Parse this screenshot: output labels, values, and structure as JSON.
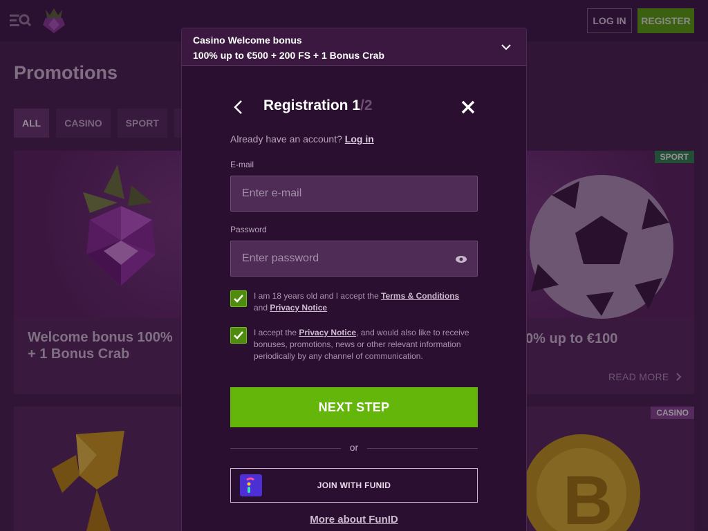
{
  "header": {
    "login_label": "LOG IN",
    "register_label": "REGISTER"
  },
  "page": {
    "title": "Promotions",
    "tabs": [
      "ALL",
      "CASINO",
      "SPORT",
      "S"
    ]
  },
  "cards": {
    "left_title_line1": "Welcome bonus 100%",
    "left_title_line2": "+ 1 Bonus Crab",
    "right_title": "0% up to €100",
    "right_badge": "SPORT",
    "bottom_right_badge": "CASINO",
    "read_more": "READ MORE"
  },
  "modal": {
    "bonus_title": "Casino Welcome bonus",
    "bonus_offer": "100% up to €500 + 200 FS + 1 Bonus Crab",
    "title": "Registration",
    "step": "1",
    "total": "/2",
    "account_prompt": "Already have an account?",
    "login_link": "Log in",
    "email_label": "E-mail",
    "email_placeholder": "Enter e-mail",
    "password_label": "Password",
    "password_placeholder": "Enter password",
    "terms_text_a": "I am 18 years old and I accept the ",
    "terms_link": "Terms & Conditions",
    "terms_text_b": " and ",
    "privacy_link": "Privacy Notice",
    "marketing_text_a": "I accept the ",
    "marketing_privacy_link": "Privacy Notice",
    "marketing_text_b": ", and would also like to receive bonuses, promotions, news or other relevant information periodically by any channel of communication.",
    "next_label": "NEXT STEP",
    "or_label": "or",
    "funid_label": "JOIN WITH FUNID",
    "more_funid": "More about FunID"
  },
  "colors": {
    "accent_green": "#64b70a",
    "modal_bg": "#2b0f31",
    "page_bg": "#4a2450"
  },
  "icons": [
    "menu-search-icon",
    "raspberry-logo-icon",
    "chevron-down-icon",
    "back-arrow-icon",
    "close-icon",
    "eye-icon",
    "checkmark-icon",
    "chevron-right-icon",
    "funid-logo-icon"
  ]
}
